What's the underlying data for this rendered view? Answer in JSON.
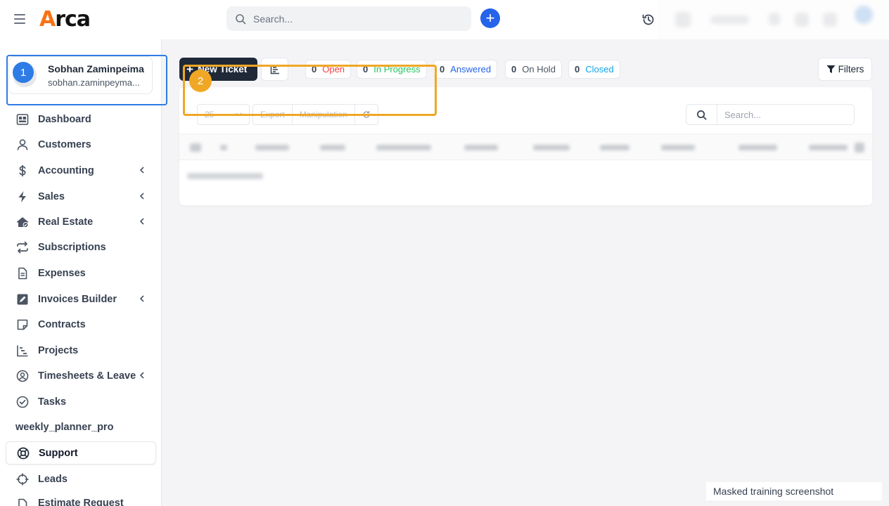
{
  "header": {
    "logo_text": "Arca",
    "search_placeholder": "Search..."
  },
  "profile": {
    "name": "Sobhan Zaminpeima",
    "email": "sobhan.zaminpeyma..."
  },
  "sidebar": {
    "items": [
      {
        "label": "Dashboard",
        "icon": "dashboard-icon"
      },
      {
        "label": "Customers",
        "icon": "user-icon"
      },
      {
        "label": "Accounting",
        "icon": "dollar-icon",
        "has_submenu": true
      },
      {
        "label": "Sales",
        "icon": "bolt-icon",
        "has_submenu": true
      },
      {
        "label": "Real Estate",
        "icon": "house-icon",
        "has_submenu": true
      },
      {
        "label": "Subscriptions",
        "icon": "repeat-icon"
      },
      {
        "label": "Expenses",
        "icon": "file-icon"
      },
      {
        "label": "Invoices Builder",
        "icon": "edit-icon",
        "has_submenu": true
      },
      {
        "label": "Contracts",
        "icon": "note-icon"
      },
      {
        "label": "Projects",
        "icon": "gantt-icon"
      },
      {
        "label": "Timesheets & Leave",
        "icon": "user-circle-icon",
        "has_submenu": true
      },
      {
        "label": "Tasks",
        "icon": "check-circle-icon"
      },
      {
        "label": "weekly_planner_pro",
        "icon": ""
      },
      {
        "label": "Support",
        "icon": "lifebuoy-icon",
        "active": true
      },
      {
        "label": "Leads",
        "icon": "crosshair-icon"
      },
      {
        "label": "Estimate Request",
        "icon": "file-icon"
      }
    ]
  },
  "toolbar": {
    "new_ticket_label": "New Ticket",
    "filters_label": "Filters",
    "statuses": [
      {
        "count": "0",
        "label": "Open",
        "color": "#ef4444"
      },
      {
        "count": "0",
        "label": "In Progress",
        "color": "#22c55e"
      },
      {
        "count": "0",
        "label": "Answered",
        "color": "#2563eb"
      },
      {
        "count": "0",
        "label": "On Hold",
        "color": "#4b5563"
      },
      {
        "count": "0",
        "label": "Closed",
        "color": "#0ea5e9"
      }
    ]
  },
  "table": {
    "page_size": "25",
    "export_label": "Export",
    "manipulation_label": "Manipulation",
    "search_placeholder": "Search..."
  },
  "annotations": {
    "one": "1",
    "two": "2"
  },
  "colors": {
    "accent": "#2563eb",
    "annotation_blue": "#2f7be5",
    "annotation_orange": "#f0a725"
  },
  "watermark": "Masked training screenshot"
}
